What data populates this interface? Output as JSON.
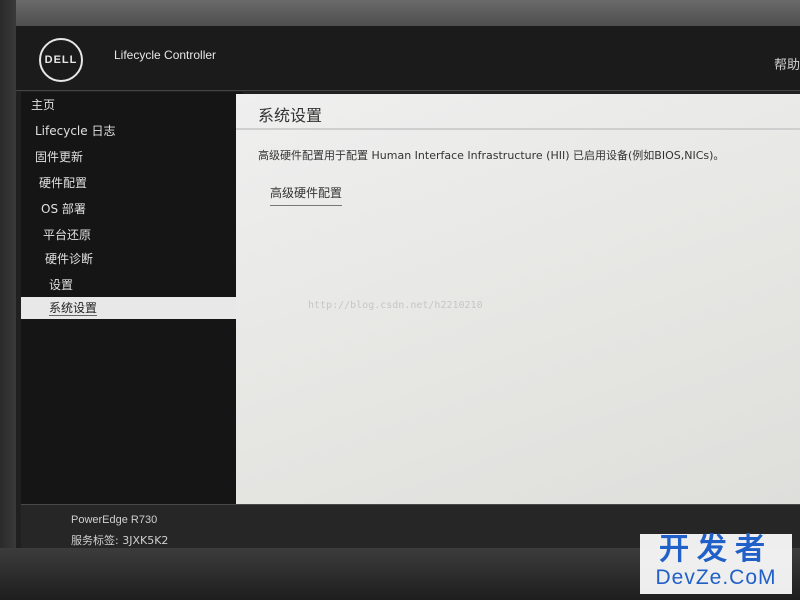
{
  "header": {
    "logo_text": "DELL",
    "app_title": "Lifecycle Controller",
    "help_label": "帮助"
  },
  "sidebar": {
    "items": [
      {
        "label": "主页"
      },
      {
        "label": "Lifecycle 日志"
      },
      {
        "label": "固件更新"
      },
      {
        "label": "硬件配置"
      },
      {
        "label": "OS 部署"
      },
      {
        "label": "平台还原"
      },
      {
        "label": "硬件诊断"
      },
      {
        "label": "设置"
      },
      {
        "label": "系统设置",
        "active": true
      }
    ]
  },
  "main": {
    "title": "系统设置",
    "description": "高级硬件配置用于配置 Human Interface Infrastructure (HII) 已启用设备(例如BIOS,NICs)。",
    "link_label": "高级硬件配置",
    "watermark_url": "http://blog.csdn.net/h2210210"
  },
  "footer": {
    "model": "PowerEdge R730",
    "service_tag": "服务标签: 3JXK5K2"
  },
  "watermark": {
    "cn": "开发者",
    "en": "DevZe.CoM"
  },
  "colors": {
    "sidebar_bg": "#151515",
    "content_bg": "#efefef",
    "active_item_bg": "#e8e8e8",
    "watermark_blue": "#2060c8"
  }
}
